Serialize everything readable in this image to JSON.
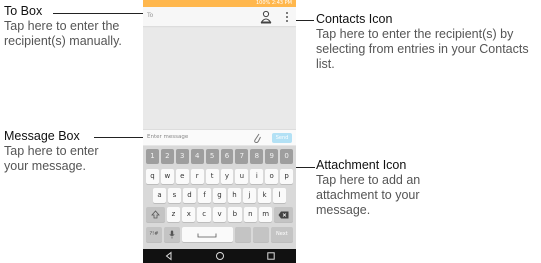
{
  "phone": {
    "status_text": "100% 2:43 PM",
    "to_placeholder": "To",
    "message_placeholder": "Enter message",
    "send_label": "Send"
  },
  "keyboard": {
    "numbers": [
      "1",
      "2",
      "3",
      "4",
      "5",
      "6",
      "7",
      "8",
      "9",
      "0"
    ],
    "row1": [
      "q",
      "w",
      "e",
      "r",
      "t",
      "y",
      "u",
      "i",
      "o",
      "p"
    ],
    "row2": [
      "a",
      "s",
      "d",
      "f",
      "g",
      "h",
      "j",
      "k",
      "l"
    ],
    "row3": [
      "z",
      "x",
      "c",
      "v",
      "b",
      "n",
      "m"
    ],
    "symbols_label": "?!#",
    "next_label": "Next"
  },
  "callouts": {
    "to_box": {
      "title": "To Box",
      "desc": "Tap here to enter the recipient(s) manually."
    },
    "message_box": {
      "title": "Message Box",
      "desc": "Tap here to enter your message."
    },
    "contacts_icon": {
      "title": "Contacts Icon",
      "desc": "Tap here to enter the recipient(s) by selecting from entries in your Contacts list."
    },
    "attachment_icon": {
      "title": "Attachment Icon",
      "desc": "Tap here to add an attachment to your message."
    }
  },
  "colors": {
    "status_bar": "#ffb74d",
    "send_button": "#b3e1f5",
    "nav_bar": "#111111"
  }
}
